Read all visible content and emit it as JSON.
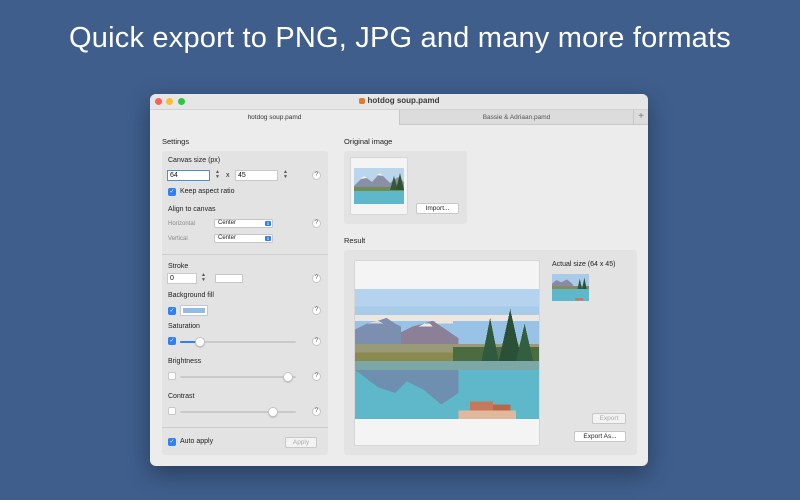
{
  "headline": "Quick export to PNG, JPG and many more formats",
  "window": {
    "title": "hotdog soup.pamd",
    "tabs": [
      {
        "label": "hotdog soup.pamd",
        "active": true
      },
      {
        "label": "Bassie & Adriaan.pamd",
        "active": false
      }
    ],
    "tab_add": "+"
  },
  "settings": {
    "title": "Settings",
    "canvas_size": {
      "label": "Canvas size (px)",
      "width": "64",
      "separator": "x",
      "height": "45",
      "keep_aspect": {
        "label": "Keep aspect ratio",
        "checked": true
      }
    },
    "align": {
      "label": "Align to canvas",
      "horizontal_label": "Horizontal",
      "horizontal_value": "Center",
      "vertical_label": "Vertical",
      "vertical_value": "Center"
    },
    "stroke": {
      "label": "Stroke",
      "value": "0",
      "color": "#ffffff"
    },
    "background_fill": {
      "label": "Background fill",
      "checked": true,
      "color": "#8fbde6"
    },
    "saturation": {
      "label": "Saturation",
      "checked": true,
      "value": 0.17
    },
    "brightness": {
      "label": "Brightness",
      "checked": false,
      "value": 0.93
    },
    "contrast": {
      "label": "Contrast",
      "checked": false,
      "value": 0.8
    },
    "auto_apply": {
      "label": "Auto apply",
      "checked": true
    },
    "apply_button": "Apply",
    "help": "?"
  },
  "original": {
    "title": "Original image",
    "import_button": "Import..."
  },
  "result": {
    "title": "Result",
    "actual_size": "Actual size (64 x 45)",
    "export_button": "Export",
    "export_as_button": "Export As..."
  },
  "colors": {
    "background": "#3f5e8c",
    "accent": "#2f7ff5",
    "sky": "#8fbde6",
    "water": "#5fb8c9"
  },
  "icons": {
    "check": "checkmark-icon",
    "stepper": "stepper-arrows-icon",
    "select": "popup-arrows-icon"
  }
}
